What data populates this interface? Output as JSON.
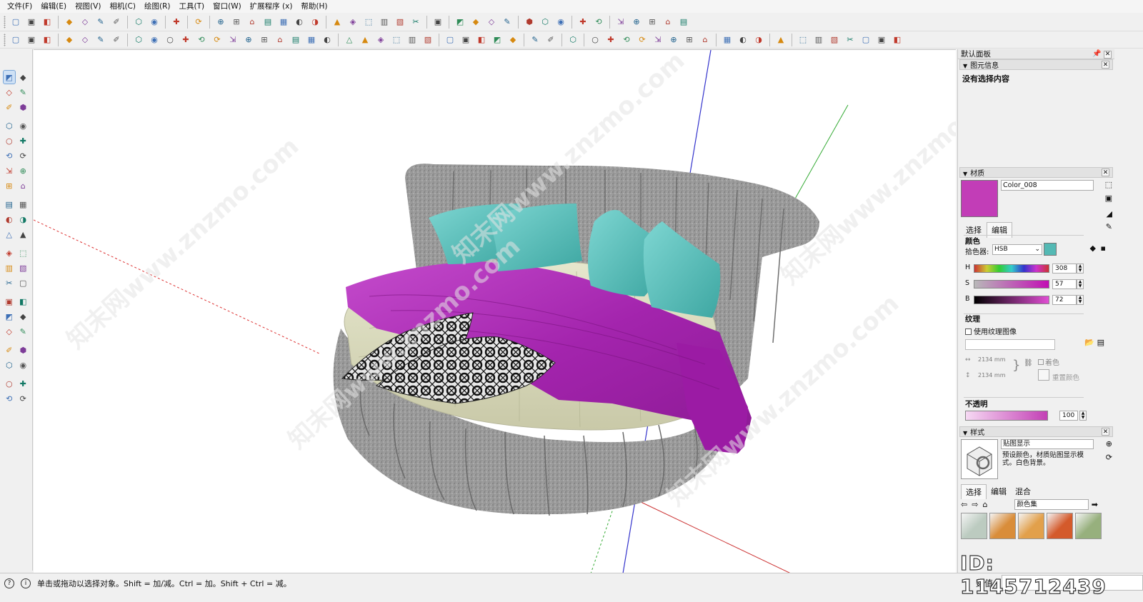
{
  "menu": [
    "文件(F)",
    "编辑(E)",
    "视图(V)",
    "相机(C)",
    "绘图(R)",
    "工具(T)",
    "窗口(W)",
    "扩展程序 (x)",
    "帮助(H)"
  ],
  "toolbar1_icons": [
    "new-icon",
    "open-icon",
    "save-icon",
    "|",
    "cut-icon",
    "copy-icon",
    "paste-icon",
    "erase-icon",
    "|",
    "undo-icon",
    "redo-icon",
    "|",
    "print-icon",
    "|",
    "model-info-icon",
    "|",
    "xray-icon",
    "back-edges-icon",
    "wireframe-icon",
    "hidden-line-icon",
    "shaded-icon",
    "shaded-textures-icon",
    "monochrome-icon",
    "|",
    "iso-view-icon",
    "top-view-icon",
    "front-view-icon",
    "right-view-icon",
    "back-view-icon",
    "left-view-icon",
    "|",
    "components-icon",
    "|",
    "section-plane-icon",
    "section-cut-icon",
    "section-fill-icon",
    "display-sections-icon",
    "|",
    "axes-icon",
    "perspective-icon",
    "parallel-icon",
    "|",
    "warehouse-icon",
    "extension-icon",
    "|",
    "layout-icon",
    "style-builder-icon",
    "sandbox-icon",
    "terrain-icon",
    "sketchup-icon"
  ],
  "toolbar2_icons": [
    "grid-a-icon",
    "grid-b-icon",
    "grid-c-icon",
    "|",
    "stair-icon",
    "column-icon",
    "beam-icon",
    "bar-chart-icon",
    "|",
    "plugin-1-icon",
    "plugin-2-icon",
    "plugin-3-icon",
    "plugin-4-icon",
    "plugin-5-icon",
    "plugin-6-icon",
    "plugin-7-icon",
    "plugin-8-icon",
    "plugin-9-icon",
    "plugin-10-icon",
    "plugin-11-icon",
    "plugin-12-icon",
    "plugin-13-icon",
    "|",
    "arc-icon",
    "wave-icon",
    "curve-icon",
    "tape-icon",
    "angle-icon",
    "rail-icon",
    "|",
    "bridge-icon",
    "dots-icon",
    "panel-icon",
    "spray-icon",
    "knife-icon",
    "|",
    "camera-a-icon",
    "camera-b-icon",
    "|",
    "cloud-icon",
    "|",
    "layer-red-icon",
    "layer-green-icon",
    "layer-blue-icon",
    "layer-yellow-icon",
    "layer-orange-icon",
    "layer-pink-icon",
    "layer-purple-icon",
    "layer-gray-icon",
    "|",
    "shield-icon",
    "lock-icon",
    "leaf-icon",
    "|",
    "vray-icon",
    "|",
    "skin-icon",
    "xyz-icon",
    "rhino-icon",
    "play-icon",
    "stop-icon",
    "render-icon",
    "refresh-icon"
  ],
  "left_tools": [
    [
      "select-icon",
      "orbit-icon"
    ],
    [
      "paint-bucket-icon",
      "eraser-icon"
    ],
    [
      "component-icon",
      "brush-icon"
    ],
    [
      "sep"
    ],
    [
      "pencil-icon",
      "freehand-icon"
    ],
    [
      "rectangle-icon",
      "rotated-rect-icon"
    ],
    [
      "circle-icon",
      "polygon-icon"
    ],
    [
      "arc-icon",
      "two-point-arc-icon"
    ],
    [
      "pie-icon",
      "three-point-arc-icon"
    ],
    [
      "sep"
    ],
    [
      "move-icon",
      "push-pull-icon"
    ],
    [
      "rotate-icon",
      "follow-me-icon"
    ],
    [
      "scale-icon",
      "offset-icon"
    ],
    [
      "sep"
    ],
    [
      "tape-measure-icon",
      "dimension-icon"
    ],
    [
      "protractor-icon",
      "text-icon"
    ],
    [
      "axes-tool-icon",
      "3d-text-icon"
    ],
    [
      "sep"
    ],
    [
      "orbit-tool-icon",
      "pan-icon"
    ],
    [
      "zoom-icon",
      "zoom-window-icon"
    ],
    [
      "zoom-extents-icon",
      "zoom-prev-icon"
    ],
    [
      "sep"
    ],
    [
      "position-camera-icon",
      "look-around-icon"
    ],
    [
      "walk-icon",
      "section-icon"
    ],
    [
      "sep"
    ],
    [
      "sandbox-a-icon",
      "sandbox-b-icon"
    ],
    [
      "sandbox-c-icon",
      "sandbox-d-icon"
    ]
  ],
  "status": {
    "text": "单击或拖动以选择对象。Shift = 加/减。Ctrl = 加。Shift + Ctrl = 减。",
    "measure_label": "数值",
    "measure_value": ""
  },
  "panel": {
    "title": "默认面板",
    "entity_info": {
      "title": "图元信息",
      "content": "没有选择内容"
    },
    "materials": {
      "title": "材质",
      "name": "Color_008",
      "swatch_color": "#c23db7",
      "tabs": [
        "选择",
        "编辑"
      ],
      "color_section": "颜色",
      "picker_label": "拾色器:",
      "picker_mode": "HSB",
      "picker_swatch_color": "#54b9b4",
      "H": {
        "label": "H",
        "value": "308"
      },
      "S": {
        "label": "S",
        "value": "57"
      },
      "B": {
        "label": "B",
        "value": "72"
      },
      "texture_section": "纹理",
      "use_texture": "使用纹理图像",
      "tex_width": "2134 mm",
      "tex_height": "2134 mm",
      "colorize": "着色",
      "reset_color": "重置颜色",
      "opacity_section": "不透明",
      "opacity_value": "100"
    },
    "styles": {
      "title": "样式",
      "name": "贴图显示",
      "description": "预设颜色，材质贴图显示模式。白色背景。",
      "tabs": [
        "选择",
        "编辑",
        "混合"
      ],
      "collection": "颜色集",
      "swatch_colors": [
        "#bccbc0",
        "#d98d3a",
        "#e2a04b",
        "#d45a2b",
        "#97b07d"
      ]
    }
  },
  "watermark_id": "ID: 1145712439"
}
